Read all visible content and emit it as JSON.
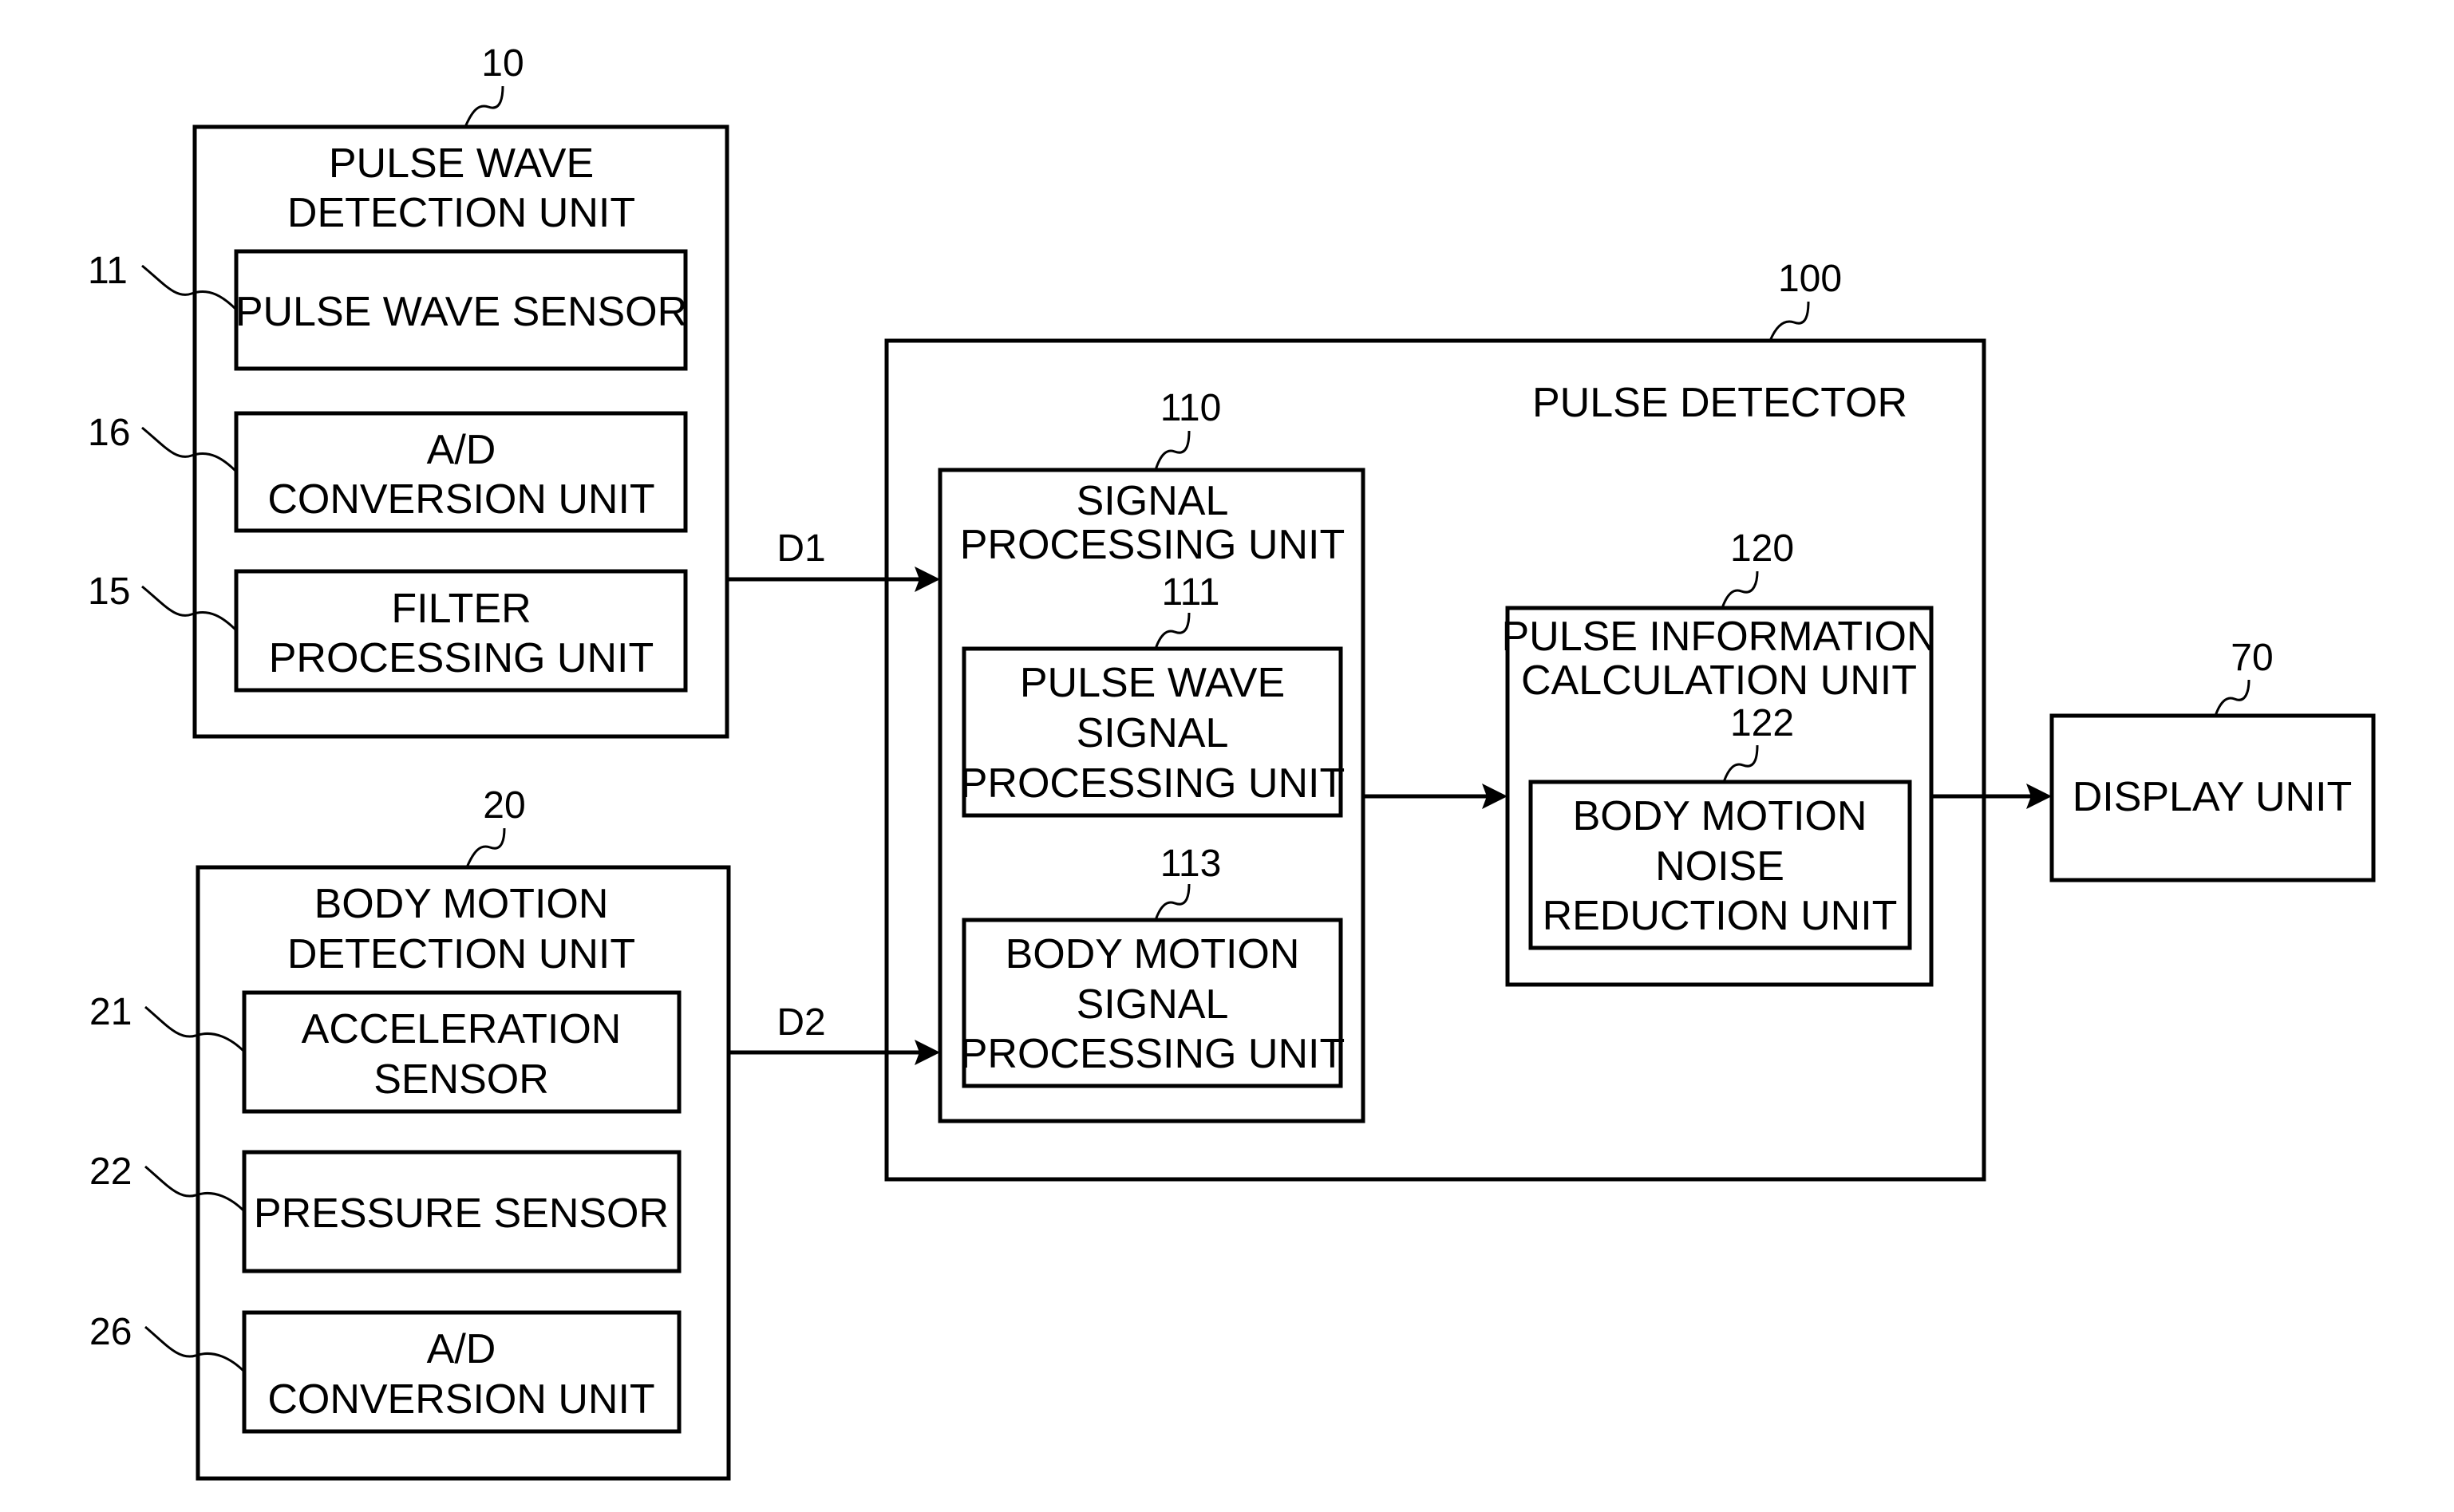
{
  "diagram": {
    "type": "block-diagram",
    "blocks": {
      "pulse_wave_detection_unit": {
        "ref": "10",
        "lines": [
          "PULSE WAVE",
          "DETECTION UNIT"
        ]
      },
      "pulse_wave_sensor": {
        "ref": "11",
        "lines": [
          "PULSE WAVE SENSOR"
        ]
      },
      "ad_conversion_unit_16": {
        "ref": "16",
        "lines": [
          "A/D",
          "CONVERSION UNIT"
        ]
      },
      "filter_processing_unit": {
        "ref": "15",
        "lines": [
          "FILTER",
          "PROCESSING UNIT"
        ]
      },
      "body_motion_detection_unit": {
        "ref": "20",
        "lines": [
          "BODY MOTION",
          "DETECTION UNIT"
        ]
      },
      "acceleration_sensor": {
        "ref": "21",
        "lines": [
          "ACCELERATION",
          "SENSOR"
        ]
      },
      "pressure_sensor": {
        "ref": "22",
        "lines": [
          "PRESSURE SENSOR"
        ]
      },
      "ad_conversion_unit_26": {
        "ref": "26",
        "lines": [
          "A/D",
          "CONVERSION UNIT"
        ]
      },
      "pulse_detector": {
        "ref": "100",
        "lines": [
          "PULSE DETECTOR"
        ]
      },
      "signal_processing_unit": {
        "ref": "110",
        "lines": [
          "SIGNAL",
          "PROCESSING UNIT"
        ]
      },
      "pulse_wave_signal_processing_unit": {
        "ref": "111",
        "lines": [
          "PULSE WAVE",
          "SIGNAL",
          "PROCESSING UNIT"
        ]
      },
      "body_motion_signal_processing_unit": {
        "ref": "113",
        "lines": [
          "BODY MOTION",
          "SIGNAL",
          "PROCESSING UNIT"
        ]
      },
      "pulse_information_calculation_unit": {
        "ref": "120",
        "lines": [
          "PULSE INFORMATION",
          "CALCULATION UNIT"
        ]
      },
      "body_motion_noise_reduction_unit": {
        "ref": "122",
        "lines": [
          "BODY MOTION",
          "NOISE",
          "REDUCTION UNIT"
        ]
      },
      "display_unit": {
        "ref": "70",
        "lines": [
          "DISPLAY UNIT"
        ]
      }
    },
    "edges": [
      {
        "from": "pulse_wave_detection_unit",
        "to": "signal_processing_unit",
        "label": "D1"
      },
      {
        "from": "body_motion_detection_unit",
        "to": "signal_processing_unit",
        "label": "D2"
      },
      {
        "from": "signal_processing_unit",
        "to": "pulse_information_calculation_unit",
        "label": ""
      },
      {
        "from": "pulse_information_calculation_unit",
        "to": "display_unit",
        "label": ""
      }
    ]
  }
}
